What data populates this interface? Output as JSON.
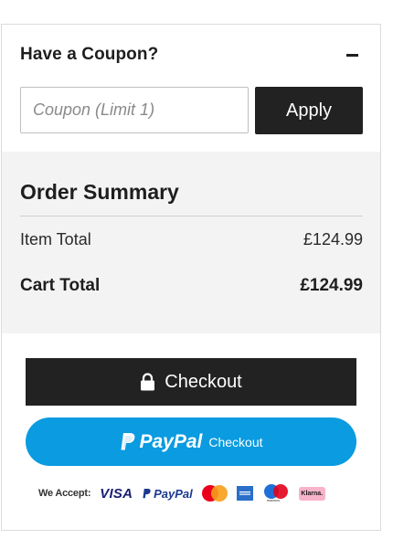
{
  "coupon": {
    "title": "Have a Coupon?",
    "toggle_icon": "minus-icon",
    "input_placeholder": "Coupon (Limit 1)",
    "input_value": "",
    "apply_label": "Apply"
  },
  "summary": {
    "title": "Order Summary",
    "item_total_label": "Item Total",
    "item_total_value": "£124.99",
    "cart_total_label": "Cart Total",
    "cart_total_value": "£124.99"
  },
  "checkout": {
    "label": "Checkout",
    "icon": "lock-icon"
  },
  "paypal": {
    "brand": "PayPal",
    "label": "Checkout",
    "color": "#0a9be0"
  },
  "payment_methods": {
    "label": "We Accept:",
    "visa": "VISA",
    "paypal": "PayPal",
    "maestro_caption": "maestro",
    "klarna": "Klarna."
  },
  "colors": {
    "dark_button": "#222222",
    "summary_bg": "#f3f3f4"
  }
}
